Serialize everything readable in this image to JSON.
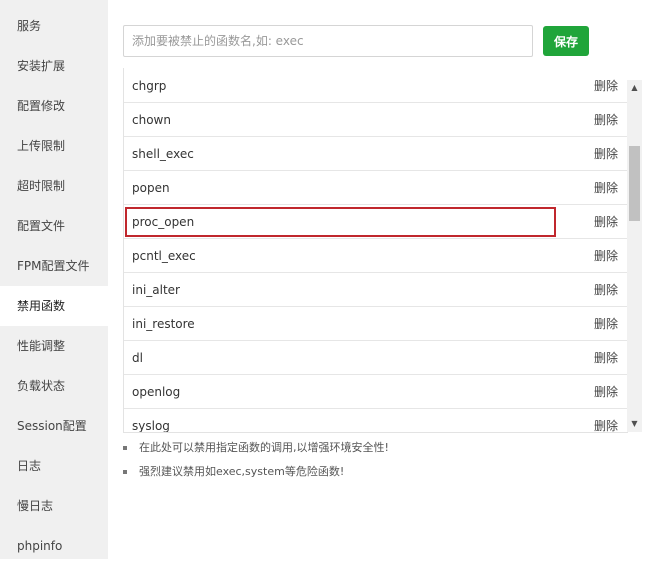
{
  "sidebar": {
    "items": [
      {
        "label": "服务",
        "active": false
      },
      {
        "label": "安装扩展",
        "active": false
      },
      {
        "label": "配置修改",
        "active": false
      },
      {
        "label": "上传限制",
        "active": false
      },
      {
        "label": "超时限制",
        "active": false
      },
      {
        "label": "配置文件",
        "active": false
      },
      {
        "label": "FPM配置文件",
        "active": false
      },
      {
        "label": "禁用函数",
        "active": true
      },
      {
        "label": "性能调整",
        "active": false
      },
      {
        "label": "负载状态",
        "active": false
      },
      {
        "label": "Session配置",
        "active": false
      },
      {
        "label": "日志",
        "active": false
      },
      {
        "label": "慢日志",
        "active": false
      },
      {
        "label": "phpinfo",
        "active": false
      }
    ]
  },
  "form": {
    "placeholder": "添加要被禁止的函数名,如: exec",
    "value": "",
    "save_label": "保存"
  },
  "list": {
    "delete_label": "删除",
    "highlighted": "proc_open",
    "rows": [
      {
        "name": "chgrp"
      },
      {
        "name": "chown"
      },
      {
        "name": "shell_exec"
      },
      {
        "name": "popen"
      },
      {
        "name": "proc_open"
      },
      {
        "name": "pcntl_exec"
      },
      {
        "name": "ini_alter"
      },
      {
        "name": "ini_restore"
      },
      {
        "name": "dl"
      },
      {
        "name": "openlog"
      },
      {
        "name": "syslog"
      }
    ]
  },
  "scrollbar": {
    "up_icon": "triangle-up",
    "down_icon": "triangle-down"
  },
  "notes": [
    "在此处可以禁用指定函数的调用,以增强环境安全性!",
    "强烈建议禁用如exec,system等危险函数!"
  ],
  "colors": {
    "accent": "#20a53a",
    "highlight_border": "#c0272d",
    "sidebar_bg": "#f0f0f0"
  }
}
